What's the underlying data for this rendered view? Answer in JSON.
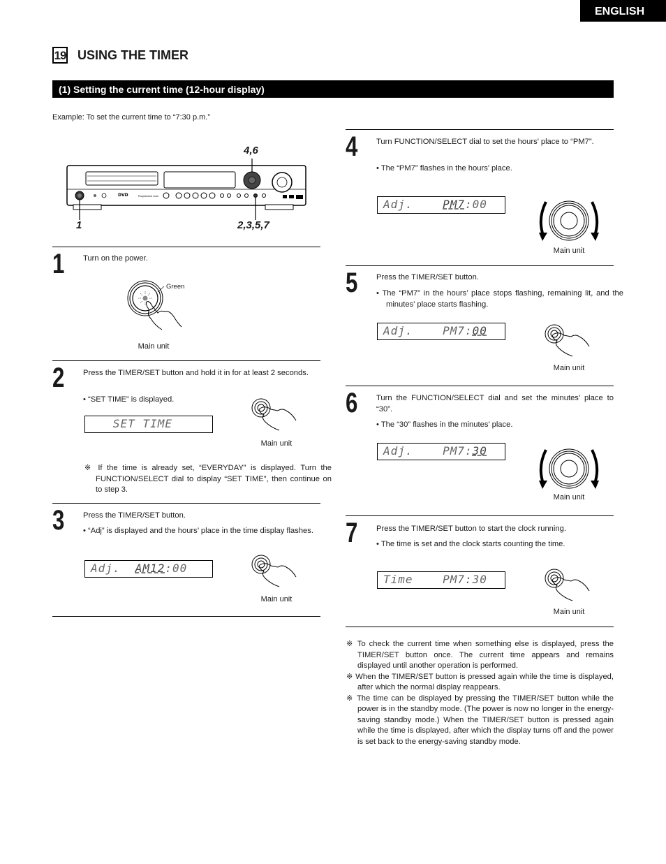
{
  "header": {
    "language_tab": "ENGLISH",
    "section_number": "19",
    "section_title": "USING THE TIMER",
    "subsection_title": "(1) Setting the current time (12-hour display)",
    "example": "Example:  To set the current time to “7:30 p.m.”"
  },
  "device_figure": {
    "callout_top": "4,6",
    "callout_left": "1",
    "callout_right": "2,3,5,7"
  },
  "steps": [
    {
      "number": "1",
      "instruction": "Turn on the power.",
      "figure": "power-button",
      "indicator_label": "Green",
      "caption": "Main unit"
    },
    {
      "number": "2",
      "instruction": "Press the TIMER/SET button and hold it in for at least 2 seconds.",
      "bullet": "•  “SET TIME” is displayed.",
      "display": {
        "prefix": "   SET TIME",
        "flash": "",
        "suffix": ""
      },
      "caption": "Main unit",
      "note": "※ If the time is already set, “EVERYDAY” is displayed. Turn the FUNCTION/SELECT dial to display “SET TIME”, then continue on to step 3."
    },
    {
      "number": "3",
      "instruction": "Press the TIMER/SET button.",
      "bullet": "•  “Adj” is displayed and the hours’ place in the time display flashes.",
      "display": {
        "prefix": "Adj.  ",
        "flash": "AM12",
        "suffix": ":00"
      },
      "caption": "Main unit"
    },
    {
      "number": "4",
      "instruction": "Turn FUNCTION/SELECT dial to set the hours’ place to “PM7”.",
      "bullet": "•  The “PM7” flashes in the hours’ place.",
      "display": {
        "prefix": "Adj.    ",
        "flash": "PM7",
        "suffix": ":00"
      },
      "caption": "Main unit"
    },
    {
      "number": "5",
      "instruction": "Press the TIMER/SET button.",
      "bullet": "•  The “PM7” in the hours’ place stops flashing, remaining lit, and the minutes’ place starts flashing.",
      "display": {
        "prefix": "Adj.    PM7:",
        "flash": "00",
        "suffix": ""
      },
      "caption": "Main unit"
    },
    {
      "number": "6",
      "instruction": "Turn the FUNCTION/SELECT dial and set the minutes’ place to “30”.",
      "bullet": "•  The “30” flashes in the minutes’ place.",
      "display": {
        "prefix": "Adj.    PM7:",
        "flash": "30",
        "suffix": ""
      },
      "caption": "Main unit"
    },
    {
      "number": "7",
      "instruction": "Press the TIMER/SET button to start the clock running.",
      "bullet": "•  The time is set and the clock starts counting the time.",
      "display": {
        "prefix": "Time    PM7:30",
        "flash": "",
        "suffix": ""
      },
      "caption": "Main unit"
    }
  ],
  "notes": [
    "※ To check the current time when something else is displayed, press the TIMER/SET button once.  The current time appears and remains displayed until another operation is performed.",
    "※ When the TIMER/SET button is pressed again while the time is displayed, after which the normal display reappears.",
    "※ The time can be displayed by pressing the TIMER/SET button while the power is in the standby mode.  (The power is now no longer in the energy-saving standby mode.)  When the TIMER/SET button is pressed again while the time is displayed, after which the display turns off and the power is set back to the energy-saving standby mode."
  ]
}
